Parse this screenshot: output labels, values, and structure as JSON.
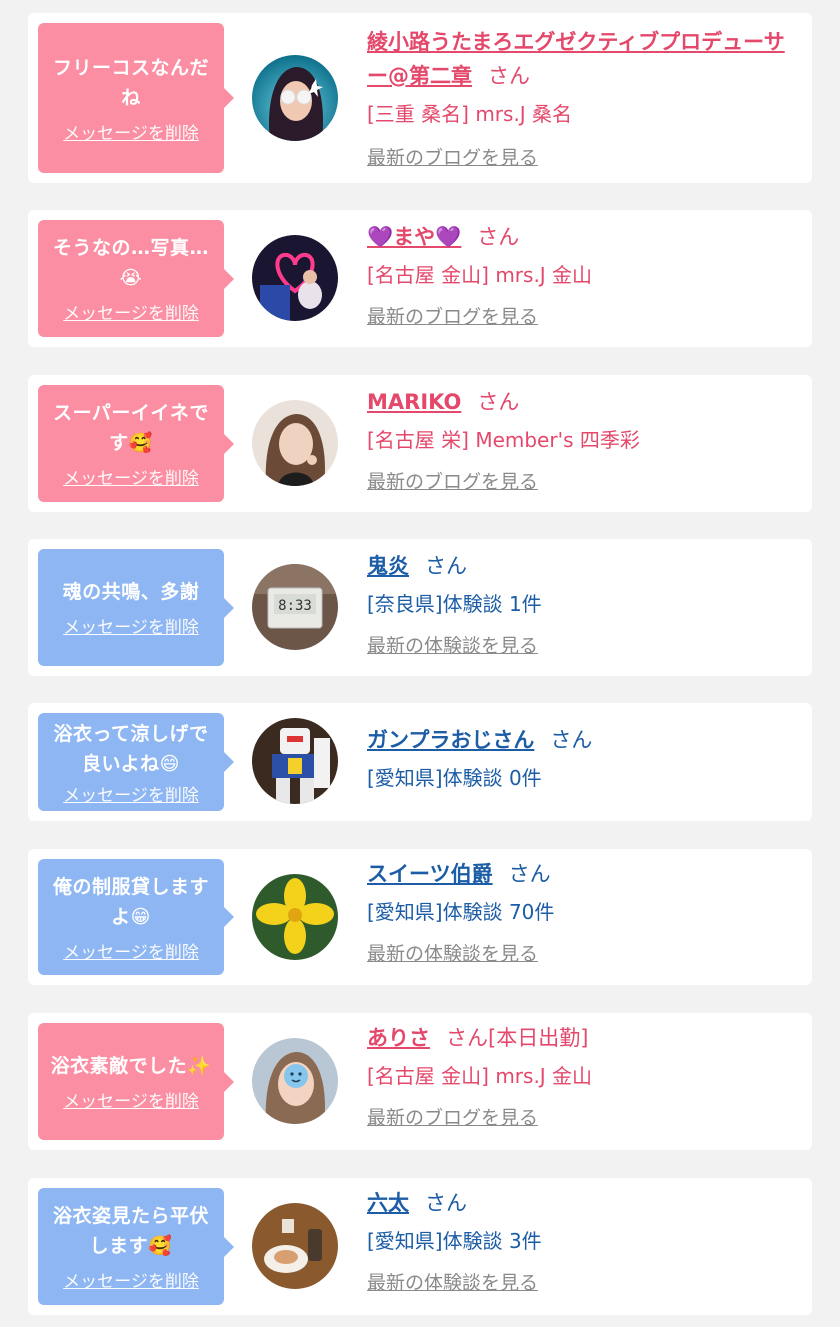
{
  "delete_label": "メッセージを削除",
  "colors": {
    "pink_bubble": "#fb8ea2",
    "blue_bubble": "#8db6f3",
    "pink_text": "#e4486b",
    "blue_text": "#1c5da6",
    "link_gray": "#8a8a8a"
  },
  "items": [
    {
      "type": "girl",
      "message": "フリーコスなんだね",
      "name": "綾小路うたまろエグゼクティブプロデューサー@第二章",
      "suffix": "さん",
      "shop": "[三重 桑名] mrs.J 桑名",
      "link": "最新のブログを見る",
      "avatar": "woman-in-sunglasses"
    },
    {
      "type": "girl",
      "message": "そうなの…写真…😭",
      "name": "💜まや💜",
      "suffix": "さん",
      "shop": "[名古屋 金山] mrs.J 金山",
      "link": "最新のブログを見る",
      "avatar": "neon-heart"
    },
    {
      "type": "girl",
      "message": "スーパーイイネです🥰",
      "name": "MARIKO",
      "suffix": "さん",
      "shop": "[名古屋 栄] Member's 四季彩",
      "link": "最新のブログを見る",
      "avatar": "woman-portrait"
    },
    {
      "type": "member",
      "message": "魂の共鳴、多謝",
      "name": "鬼炎",
      "suffix": "さん",
      "shop": "[奈良県]体験談 1件",
      "link": "最新の体験談を見る",
      "avatar": "digital-clock"
    },
    {
      "type": "member",
      "message": "浴衣って涼しげで良いよね😄",
      "name": "ガンプラおじさん",
      "suffix": "さん",
      "shop": "[愛知県]体験談 0件",
      "link": "",
      "avatar": "robot-model"
    },
    {
      "type": "member",
      "message": "俺の制服貸しますよ😁",
      "name": "スイーツ伯爵",
      "suffix": "さん",
      "shop": "[愛知県]体験談 70件",
      "link": "最新の体験談を見る",
      "avatar": "yellow-flower"
    },
    {
      "type": "girl",
      "message": "浴衣素敵でした✨",
      "name": "ありさ",
      "suffix": "さん[本日出勤]",
      "shop": "[名古屋 金山] mrs.J 金山",
      "link": "最新のブログを見る",
      "avatar": "blurred-face"
    },
    {
      "type": "member",
      "message": "浴衣姿見たら平伏します🥰",
      "name": "六太",
      "suffix": "さん",
      "shop": "[愛知県]体験談 3件",
      "link": "最新の体験談を見る",
      "avatar": "food-plate"
    }
  ]
}
